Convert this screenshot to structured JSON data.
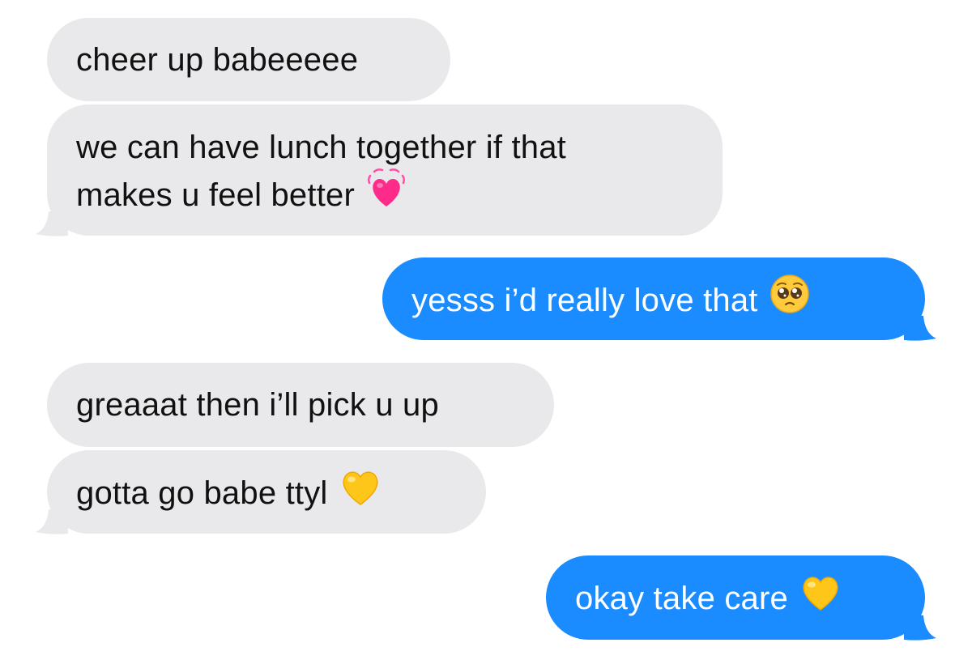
{
  "messages": [
    {
      "direction": "received",
      "text": "cheer up babeeeee"
    },
    {
      "direction": "received",
      "lines": [
        "we can have lunch together if that",
        "makes u feel better"
      ],
      "emoji": "growing-heart-icon"
    },
    {
      "direction": "sent",
      "text": "yesss i’d really love that",
      "emoji": "pleading-face-icon"
    },
    {
      "direction": "received",
      "text": "greaaat then i’ll pick u up"
    },
    {
      "direction": "received",
      "text": "gotta go babe ttyl",
      "emoji": "yellow-heart-icon"
    },
    {
      "direction": "sent",
      "text": "okay take care",
      "emoji": "yellow-heart-icon"
    }
  ],
  "colors": {
    "received_bubble": "#e9e9eb",
    "received_text": "#111111",
    "sent_bubble": "#1a8cff",
    "sent_text": "#ffffff",
    "background": "#ffffff"
  }
}
